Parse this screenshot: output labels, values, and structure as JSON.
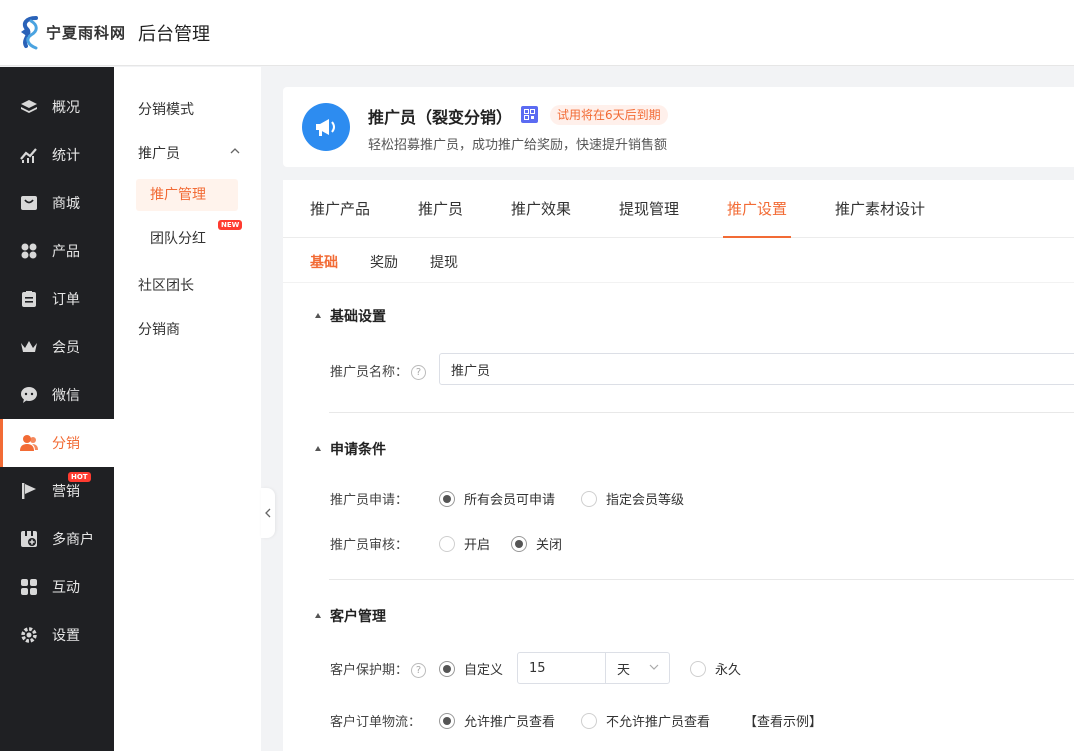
{
  "header": {
    "logo_text": "宁夏雨科网",
    "app_title": "后台管理"
  },
  "sidenav": {
    "items": [
      {
        "label": "概况",
        "icon": "layers-icon"
      },
      {
        "label": "统计",
        "icon": "chart-icon"
      },
      {
        "label": "商城",
        "icon": "store-icon"
      },
      {
        "label": "产品",
        "icon": "grid-icon"
      },
      {
        "label": "订单",
        "icon": "clipboard-icon"
      },
      {
        "label": "会员",
        "icon": "crown-icon"
      },
      {
        "label": "微信",
        "icon": "wechat-icon"
      },
      {
        "label": "分销",
        "icon": "users-icon",
        "active": true
      },
      {
        "label": "营销",
        "icon": "flag-icon",
        "badge": "HOT"
      },
      {
        "label": "多商户",
        "icon": "multi-store-icon"
      },
      {
        "label": "互动",
        "icon": "apps-icon"
      },
      {
        "label": "设置",
        "icon": "gear-icon"
      }
    ],
    "active_color": "#f26b35"
  },
  "subnav": {
    "mode": "分销模式",
    "promoter_group": "推广员",
    "children": [
      {
        "label": "推广管理",
        "active": true
      },
      {
        "label": "团队分红",
        "badge": "NEW"
      }
    ],
    "community": "社区团长",
    "distributor": "分销商"
  },
  "plugin": {
    "title": "推广员（裂变分销）",
    "trial": "试用将在6天后到期",
    "desc": "轻松招募推广员，成功推广给奖励，快速提升销售额",
    "icon": "megaphone-icon"
  },
  "tabs": [
    {
      "label": "推广产品"
    },
    {
      "label": "推广员"
    },
    {
      "label": "推广效果"
    },
    {
      "label": "提现管理"
    },
    {
      "label": "推广设置",
      "active": true
    },
    {
      "label": "推广素材设计"
    }
  ],
  "subtabs": [
    {
      "label": "基础",
      "active": true
    },
    {
      "label": "奖励"
    },
    {
      "label": "提现"
    }
  ],
  "form": {
    "basic": {
      "title": "基础设置",
      "name_label": "推广员名称：",
      "name_value": "推广员"
    },
    "apply": {
      "title": "申请条件",
      "apply_label": "推广员申请：",
      "apply_options": [
        "所有会员可申请",
        "指定会员等级"
      ],
      "apply_selected": 0,
      "review_label": "推广员审核：",
      "review_options": [
        "开启",
        "关闭"
      ],
      "review_selected": 1
    },
    "customer": {
      "title": "客户管理",
      "protect_label": "客户保护期：",
      "protect_custom": "自定义",
      "protect_days": "15",
      "protect_unit": "天",
      "protect_forever": "永久",
      "logistics_label": "客户订单物流：",
      "logistics_options": [
        "允许推广员查看",
        "不允许推广员查看"
      ],
      "logistics_selected": 0,
      "example_link": "【查看示例】"
    }
  }
}
